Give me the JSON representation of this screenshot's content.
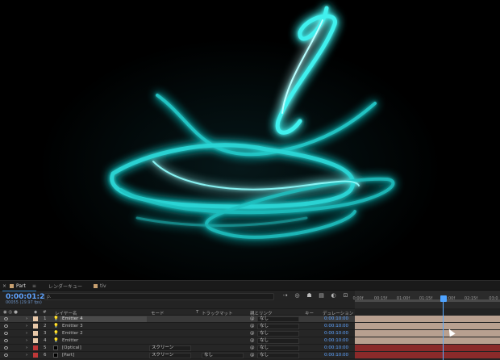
{
  "tabs": [
    {
      "label": "Part",
      "active": true,
      "color": "#c8a070"
    },
    {
      "label": "レンダーキュー",
      "active": false,
      "color": null
    },
    {
      "label": "tiv",
      "active": false,
      "color": "#c8a070"
    }
  ],
  "timecode": "0:00:01:25",
  "frame_readout": "00055 (29.97 fps)",
  "search_placeholder": "ρ.",
  "tool_icons": [
    "comp-flowchart-icon",
    "draft-3d-icon",
    "shy-icon",
    "frame-blend-icon",
    "motion-blur-icon",
    "graph-editor-icon"
  ],
  "ruler_labels": [
    "0:00f",
    "00:15f",
    "01:00f",
    "01:15f",
    "02:00f",
    "02:15f",
    "03:0"
  ],
  "columns": {
    "layer_name": "レイヤー名",
    "mode": "モード",
    "t": "T",
    "track_matte": "トラックマット",
    "parent": "親とリンク",
    "keys": "キー",
    "duration": "デュレーション"
  },
  "layers": [
    {
      "num": "1",
      "name": "Emitter 4",
      "mode": "",
      "trkmat": "",
      "parent": "なし",
      "duration": "0:00:10:00",
      "label_color": "#e8c8a8",
      "bar_color": "#b8a090",
      "selected": true,
      "icon": "light-icon"
    },
    {
      "num": "2",
      "name": "Emitter 3",
      "mode": "",
      "trkmat": "",
      "parent": "なし",
      "duration": "0:00:10:00",
      "label_color": "#e8c8a8",
      "bar_color": "#b8a090",
      "selected": false,
      "icon": "light-icon"
    },
    {
      "num": "3",
      "name": "Emitter 2",
      "mode": "",
      "trkmat": "",
      "parent": "なし",
      "duration": "0:00:10:00",
      "label_color": "#e8c8a8",
      "bar_color": "#b8a090",
      "selected": false,
      "icon": "light-icon"
    },
    {
      "num": "4",
      "name": "Emitter",
      "mode": "",
      "trkmat": "",
      "parent": "なし",
      "duration": "0:00:10:00",
      "label_color": "#e8c8a8",
      "bar_color": "#b8a090",
      "selected": false,
      "icon": "light-icon"
    },
    {
      "num": "5",
      "name": "[Optical]",
      "mode": "スクリーン",
      "trkmat": "",
      "parent": "なし",
      "duration": "0:00:10:00",
      "label_color": "#c03838",
      "bar_color": "#8a2a2a",
      "selected": false,
      "icon": "solid-icon"
    },
    {
      "num": "6",
      "name": "[Part]",
      "mode": "スクリーン",
      "trkmat": "なし",
      "parent": "なし",
      "duration": "0:00:10:00",
      "label_color": "#c03838",
      "bar_color": "#8a2a2a",
      "selected": false,
      "icon": "solid-icon"
    }
  ],
  "colors": {
    "accent": "#5ea3ff",
    "glow": "#22e0e0",
    "panel": "#232323"
  }
}
